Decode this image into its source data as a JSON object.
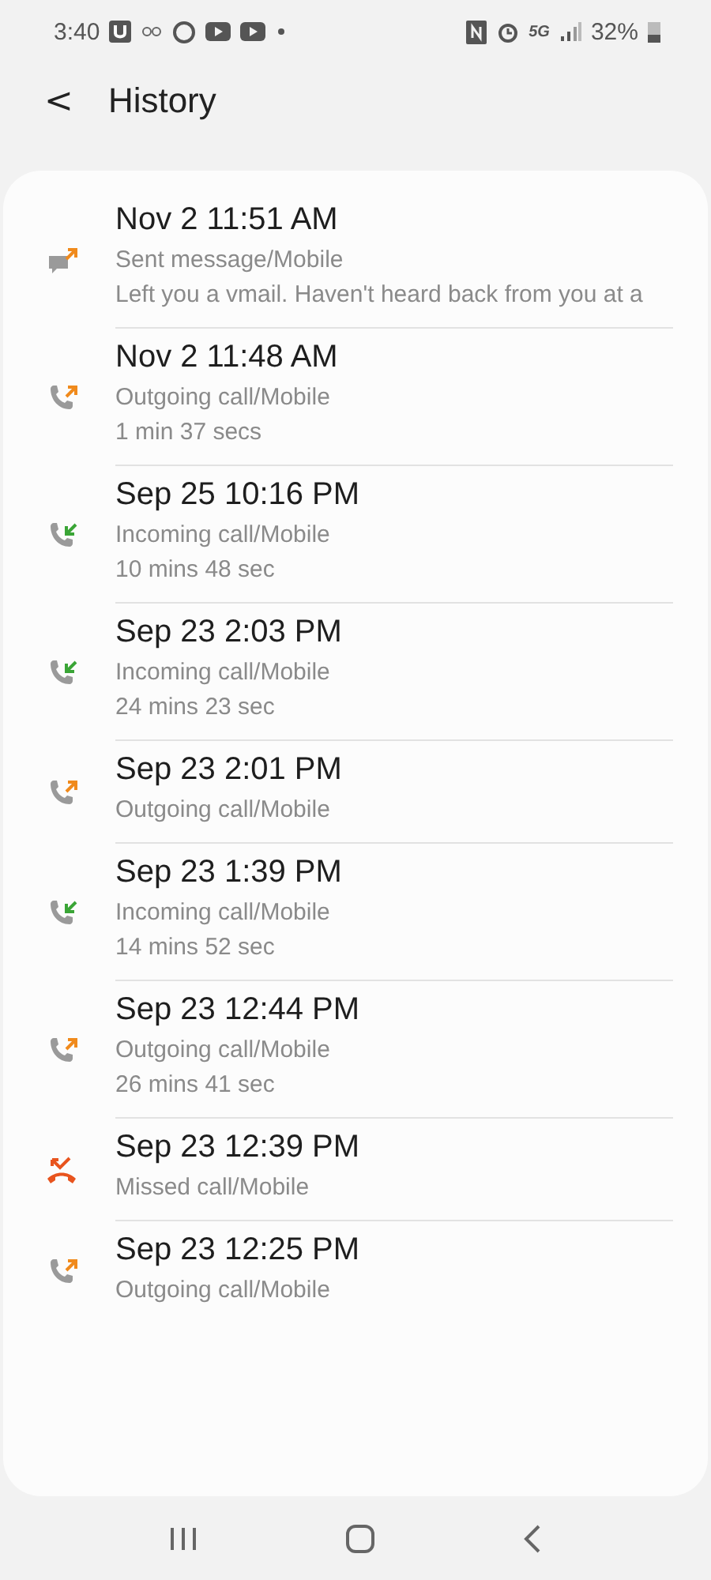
{
  "status_bar": {
    "time": "3:40",
    "network": "5G",
    "battery": "32%"
  },
  "header": {
    "back": "<",
    "title": "History"
  },
  "entries": [
    {
      "kind": "message",
      "time": "Nov 2 11:51 AM",
      "type": "Sent message/Mobile",
      "detail": "Left you a vmail. Haven't heard back from you at a"
    },
    {
      "kind": "outgoing",
      "time": "Nov 2 11:48 AM",
      "type": "Outgoing call/Mobile",
      "detail": "1 min 37 secs"
    },
    {
      "kind": "incoming",
      "time": "Sep 25 10:16 PM",
      "type": "Incoming call/Mobile",
      "detail": "10 mins 48 sec"
    },
    {
      "kind": "incoming",
      "time": "Sep 23 2:03 PM",
      "type": "Incoming call/Mobile",
      "detail": "24 mins 23 sec"
    },
    {
      "kind": "outgoing",
      "time": "Sep 23 2:01 PM",
      "type": "Outgoing call/Mobile"
    },
    {
      "kind": "incoming",
      "time": "Sep 23 1:39 PM",
      "type": "Incoming call/Mobile",
      "detail": "14 mins 52 sec"
    },
    {
      "kind": "outgoing",
      "time": "Sep 23 12:44 PM",
      "type": "Outgoing call/Mobile",
      "detail": "26 mins 41 sec"
    },
    {
      "kind": "missed",
      "time": "Sep 23 12:39 PM",
      "type": "Missed call/Mobile"
    },
    {
      "kind": "outgoing",
      "time": "Sep 23 12:25 PM",
      "type": "Outgoing call/Mobile"
    }
  ]
}
